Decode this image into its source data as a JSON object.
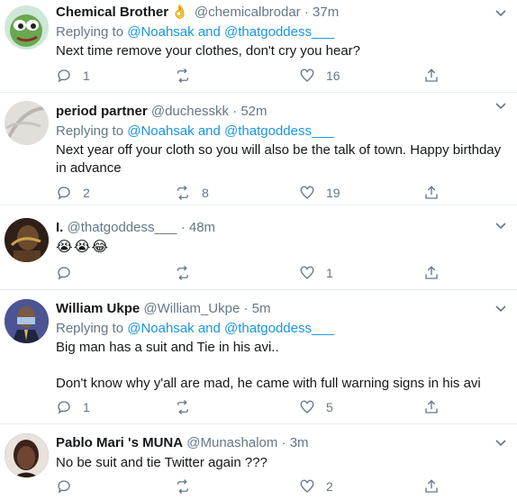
{
  "tweets": [
    {
      "name": "Chemical Brother",
      "badge": "👌",
      "handle": "@chemicalbrodar",
      "dot": "·",
      "time": "37m",
      "replying_prefix": "Replying to",
      "mentions": "@Noahsak and @thatgoddess___",
      "text_lines": [
        "Next time remove your clothes, don't cry you hear?"
      ],
      "reply_count": "1",
      "retweet_count": "",
      "like_count": "16",
      "avatar_color": "#6aa84f"
    },
    {
      "name": "period partner",
      "handle": "@duchesskk",
      "dot": "·",
      "time": "52m",
      "replying_prefix": "Replying to",
      "mentions": "@Noahsak and @thatgoddess___",
      "text_lines": [
        "Next year off your cloth so you will also be the talk of town. Happy birthday in advance"
      ],
      "reply_count": "2",
      "retweet_count": "8",
      "like_count": "19",
      "avatar_color": "#d9d6d2"
    },
    {
      "name": "I.",
      "handle": "@thatgoddess___",
      "dot": "·",
      "time": "48m",
      "text_lines": [
        "😭😭😂"
      ],
      "reply_count": "",
      "retweet_count": "",
      "like_count": "1",
      "avatar_color": "#3a2a1e"
    },
    {
      "name": "William Ukpe",
      "handle": "@William_Ukpe",
      "dot": "·",
      "time": "5m",
      "replying_prefix": "Replying to",
      "mentions": "@Noahsak and @thatgoddess___",
      "text_lines": [
        "Big man has a suit and Tie in his avi..",
        "Don't know why y'all are mad, he came with full warning signs in his avi"
      ],
      "reply_count": "1",
      "retweet_count": "",
      "like_count": "5",
      "avatar_color": "#5b5f9e"
    },
    {
      "name": "Pablo Mari 's MUNA",
      "handle": "@Munashalom",
      "dot": "·",
      "time": "3m",
      "text_lines": [
        "No be suit and tie Twitter again ???"
      ],
      "reply_count": "",
      "retweet_count": "",
      "like_count": "2",
      "avatar_color": "#4a2e22"
    }
  ],
  "colors": {
    "link": "#1b95e0",
    "muted": "#657786",
    "divider": "#e6ecf0"
  }
}
